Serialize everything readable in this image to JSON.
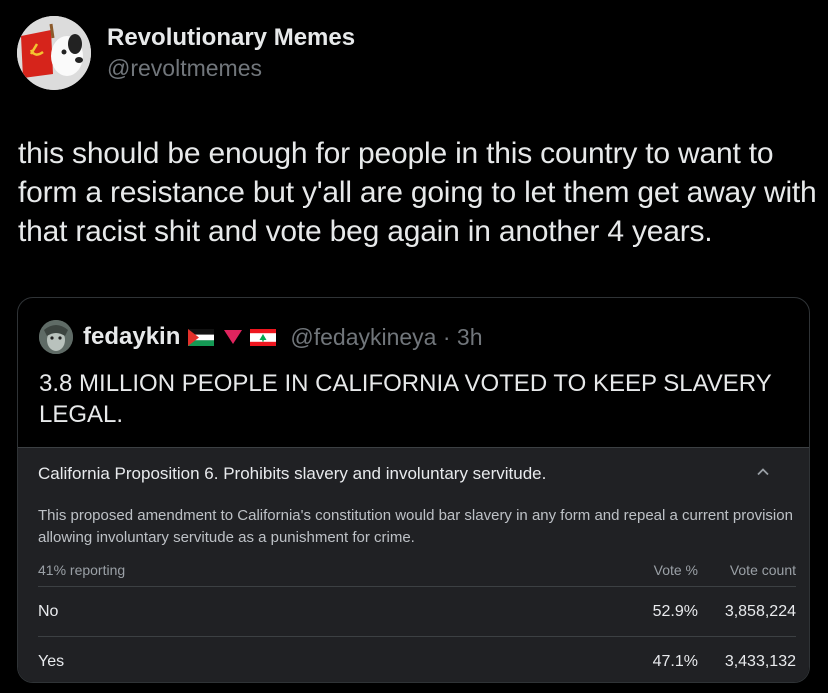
{
  "tweet": {
    "display_name": "Revolutionary Memes",
    "handle": "@revoltmemes",
    "text": "this should be enough for people in this country to want to form a resistance but y'all are going to let them get away with that racist shit and vote beg again in another 4 years.",
    "avatar_icon": "snoopy-soviet-flag-avatar-icon"
  },
  "quote": {
    "display_name": "fedaykin",
    "flags": [
      "palestine-flag-icon",
      "red-triangle-icon",
      "lebanon-flag-icon"
    ],
    "handle_time": "@fedaykineya · 3h",
    "text": "3.8 MILLION PEOPLE IN CALIFORNIA VOTED TO KEEP SLAVERY LEGAL."
  },
  "results_card": {
    "title": "California Proposition 6. Prohibits slavery and involuntary servitude.",
    "description": "This proposed amendment to California's constitution would bar slavery in any form and repeal a current provision allowing involuntary servitude as a punishment for crime.",
    "reporting": "41% reporting",
    "col_vote_pct": "Vote %",
    "col_vote_count": "Vote count",
    "rows": [
      {
        "option": "No",
        "pct": "52.9%",
        "count": "3,858,224"
      },
      {
        "option": "Yes",
        "pct": "47.1%",
        "count": "3,433,132"
      }
    ]
  },
  "colors": {
    "background": "#000000",
    "text_primary": "#e7e9ea",
    "text_secondary": "#71767b",
    "card_bg": "#202124"
  }
}
